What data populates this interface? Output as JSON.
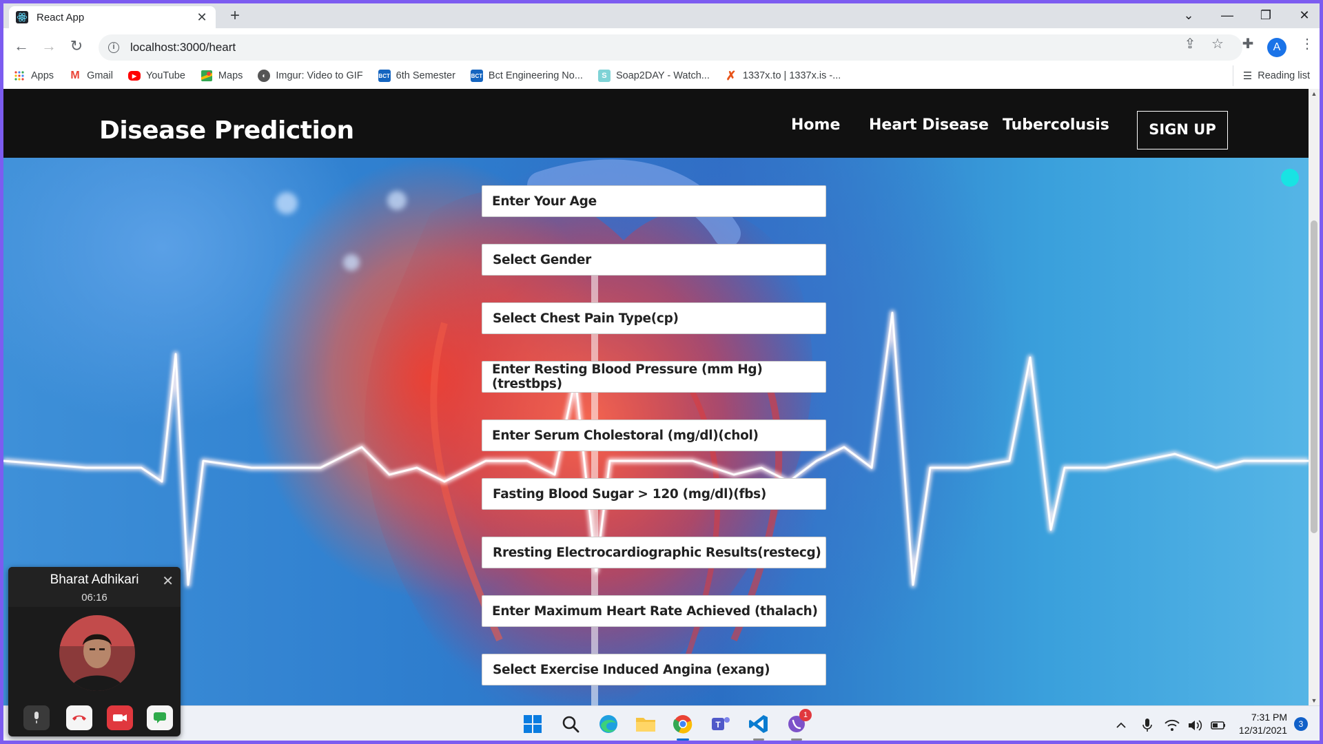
{
  "browser": {
    "tab_title": "React App",
    "url": "localhost:3000/heart",
    "profile_initial": "A",
    "bookmarks": [
      {
        "label": "Apps",
        "icon": "apps-grid-icon"
      },
      {
        "label": "Gmail",
        "icon": "gmail-icon"
      },
      {
        "label": "YouTube",
        "icon": "youtube-icon"
      },
      {
        "label": "Maps",
        "icon": "maps-icon"
      },
      {
        "label": "Imgur: Video to GIF",
        "icon": "imgur-icon"
      },
      {
        "label": "6th Semester",
        "icon": "bct-icon"
      },
      {
        "label": "Bct Engineering No...",
        "icon": "bct-icon"
      },
      {
        "label": "Soap2DAY - Watch...",
        "icon": "soap2day-icon"
      },
      {
        "label": "1337x.to | 1337x.is -...",
        "icon": "1337x-icon"
      }
    ],
    "reading_list": "Reading list"
  },
  "site": {
    "brand": "Disease Prediction",
    "nav": [
      "Home",
      "Heart Disease",
      "Tubercolusis"
    ],
    "signup": "SIGN UP"
  },
  "form": {
    "fields": [
      "Enter Your Age",
      "Select Gender",
      "Select Chest Pain Type(cp)",
      "Enter Resting Blood Pressure (mm Hg)(trestbps)",
      "Enter Serum Cholestoral (mg/dl)(chol)",
      "Fasting Blood Sugar > 120 (mg/dl)(fbs)",
      "Rresting Electrocardiographic Results(restecg)",
      "Enter Maximum Heart Rate Achieved (thalach)",
      "Select Exercise Induced Angina (exang)"
    ]
  },
  "call": {
    "name": "Bharat Adhikari",
    "duration": "06:16"
  },
  "taskbar": {
    "time": "7:31 PM",
    "date": "12/31/2021",
    "notification_count": "3",
    "viber_badge": "1"
  },
  "colors": {
    "accent_frame": "#7c5cf0",
    "navbar_bg": "#111111",
    "chrome_blue": "#1a73e8"
  }
}
